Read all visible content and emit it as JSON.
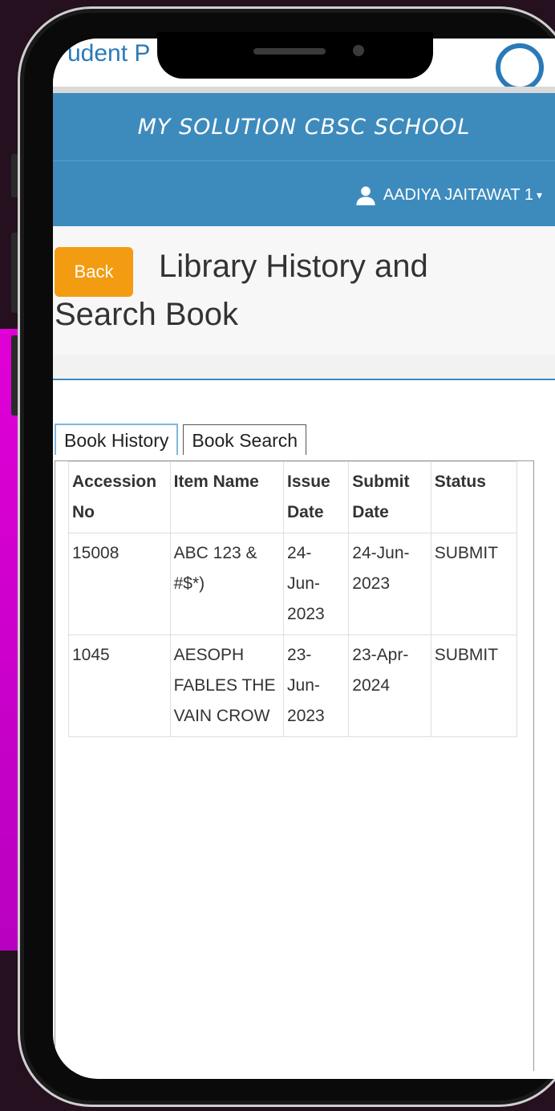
{
  "portal": {
    "title": "udent P"
  },
  "school": {
    "name": "MY SOLUTION CBSC SCHOOL"
  },
  "user": {
    "name": "AADIYA JAITAWAT 1"
  },
  "page": {
    "back_label": "Back",
    "title": "Library History and Search Book"
  },
  "tabs": [
    {
      "label": "Book History",
      "active": true
    },
    {
      "label": "Book Search",
      "active": false
    }
  ],
  "table": {
    "headers": [
      "Accession No",
      "Item Name",
      "Issue Date",
      "Submit Date",
      "Status"
    ],
    "rows": [
      [
        "15008",
        "ABC 123 & #$*)",
        "24-Jun-2023",
        "24-Jun-2023",
        "SUBMIT"
      ],
      [
        "1045",
        "AESOPH FABLES THE VAIN CROW",
        "23-Jun-2023",
        "23-Apr-2024",
        "SUBMIT"
      ]
    ]
  },
  "colors": {
    "header_blue": "#3d8bbd",
    "back_orange": "#f39c12",
    "backdrop_pink": "#e000d6"
  },
  "icons": {
    "user": "user-icon",
    "dropdown": "caret-down-icon"
  }
}
